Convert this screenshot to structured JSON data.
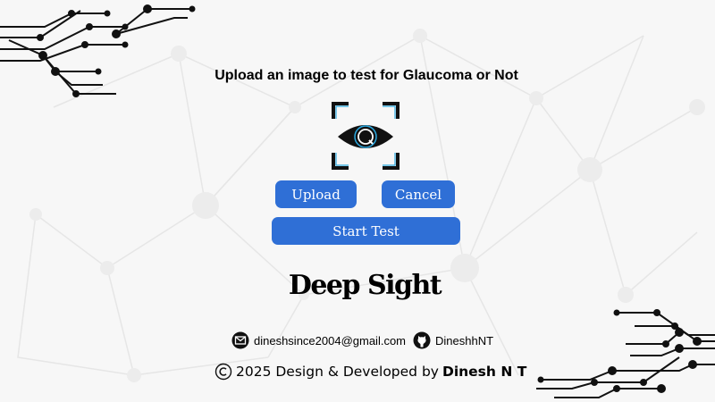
{
  "heading": "Upload an image to test for Glaucoma or Not",
  "buttons": {
    "upload": "Upload",
    "cancel": "Cancel",
    "start_test": "Start Test",
    "color": "#2f6fd6"
  },
  "brand": "Deep Sight",
  "contact": {
    "email": "dineshsince2004@gmail.com",
    "github": "DineshhNT"
  },
  "footer": {
    "copyright": "2025 Design & Developed by",
    "author": "Dinesh N T"
  },
  "icons": {
    "logo": "eye-scan-icon",
    "email": "mail-icon",
    "github": "github-icon",
    "copyright": "copyright-icon"
  }
}
